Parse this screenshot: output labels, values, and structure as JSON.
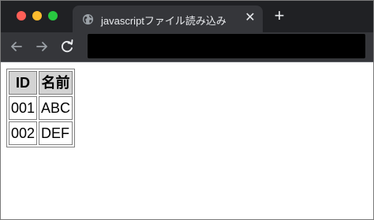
{
  "browser": {
    "tab": {
      "title": "javascriptファイル読み込み",
      "close_glyph": "✕",
      "icon": "globe-icon"
    },
    "new_tab_glyph": "+",
    "nav": {
      "back_icon": "arrow-left-icon",
      "forward_icon": "arrow-right-icon",
      "reload_icon": "reload-icon"
    },
    "address_bar": {
      "value": ""
    },
    "colors": {
      "titlebar": "#202124",
      "toolbar": "#35363a",
      "close": "#ff5f57",
      "minimize": "#febc2e",
      "maximize": "#28c840"
    }
  },
  "page": {
    "table": {
      "headers": [
        "ID",
        "名前"
      ],
      "rows": [
        [
          "001",
          "ABC"
        ],
        [
          "002",
          "DEF"
        ]
      ],
      "header_background": "#d3d3d3"
    }
  }
}
